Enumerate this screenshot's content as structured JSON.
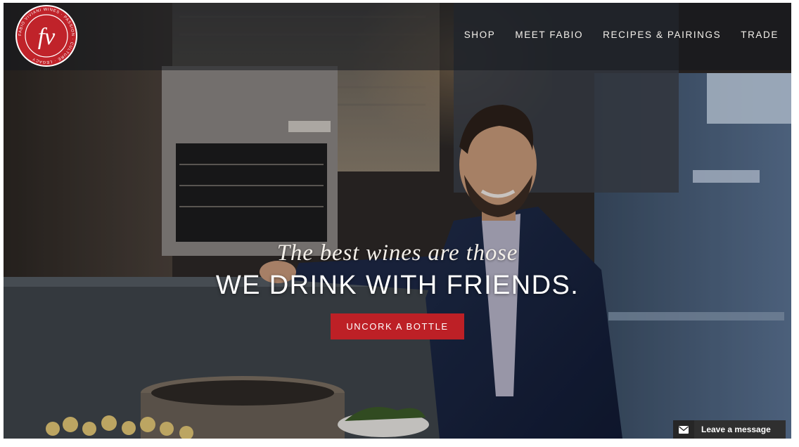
{
  "brand": {
    "logo_monogram": "fv",
    "logo_ring_text": "FABIO VIVIANI WINES · PASSION · CULTURE · LEGACY"
  },
  "nav": {
    "items": [
      {
        "label": "SHOP"
      },
      {
        "label": "MEET FABIO"
      },
      {
        "label": "RECIPES & PAIRINGS"
      },
      {
        "label": "TRADE"
      }
    ]
  },
  "hero": {
    "tagline": "The best wines are those",
    "headline": "WE DRINK WITH FRIENDS.",
    "cta_label": "UNCORK A BOTTLE"
  },
  "chat": {
    "label": "Leave a message",
    "icon": "envelope-icon"
  },
  "colors": {
    "accent": "#bd2026",
    "nav_text": "#f4f1ec",
    "header_bg": "rgba(20,24,30,0.55)"
  }
}
